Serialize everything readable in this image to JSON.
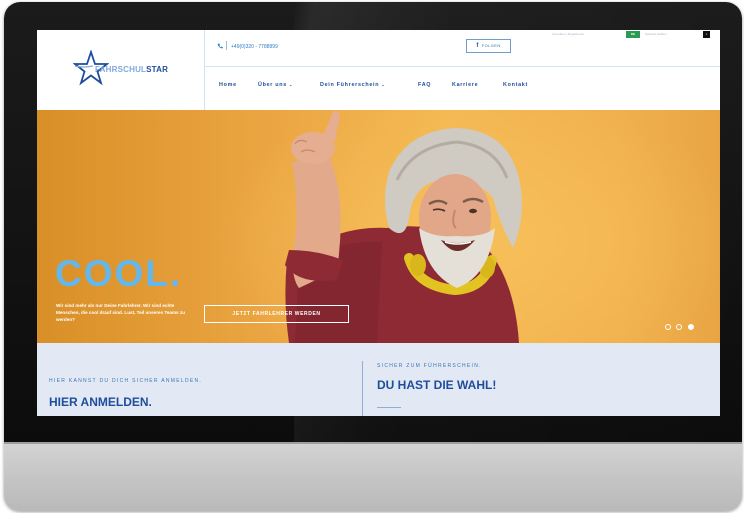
{
  "logo": {
    "part1": "FAHRSCHUL",
    "part2": "STAR"
  },
  "topbar": {
    "phone": "+49(0)320 - 7788999",
    "follow_label": "FOLGEN",
    "follow_icon": "facebook-icon",
    "tiny_link_1": "Anmelden / Registrieren",
    "tiny_link_2": "Sprache wählen",
    "lang_active": "DE",
    "lang_other": "×"
  },
  "nav": {
    "items": [
      {
        "label": "Home",
        "has_dropdown": false
      },
      {
        "label": "Über uns",
        "has_dropdown": true
      },
      {
        "label": "Dein Führerschein",
        "has_dropdown": true
      },
      {
        "label": "FAQ",
        "has_dropdown": false
      },
      {
        "label": "Karriere",
        "has_dropdown": false
      },
      {
        "label": "Kontakt",
        "has_dropdown": false
      }
    ]
  },
  "hero": {
    "title": "COOL.",
    "text": "Wir sind mehr als nur Deine Fahrlehrer. Wir sind echte Menschen, die cool drauf sind. Lust, Teil unseres Teams zu werden?",
    "button_label": "JETZT FAHRLEHRER WERDEN",
    "slides": 3,
    "active_slide": 3
  },
  "band": {
    "left_subtitle": "HIER KANNST DU DICH SICHER ANMELDEN.",
    "left_title": "HIER ANMELDEN.",
    "right_subtitle": "SICHER ZUM FÜHRERSCHEIN.",
    "right_title": "DU HAST DIE WAHL!"
  },
  "colors": {
    "brand_blue": "#1e4d9b",
    "light_blue": "#64b7ea",
    "hero_orange": "#eba643",
    "band_bg": "#e3e9f4",
    "lang_green": "#2d9a53"
  }
}
